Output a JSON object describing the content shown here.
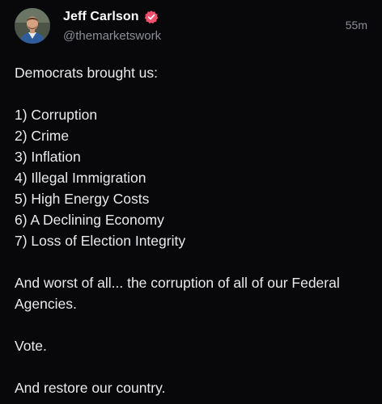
{
  "author": {
    "display_name": "Jeff Carlson",
    "handle": "@themarketswork",
    "verified_badge_color": "#f0506e",
    "avatar_icon": "profile-photo"
  },
  "post": {
    "timestamp": "55m",
    "intro": "Democrats brought us:",
    "list": [
      "1) Corruption",
      "2) Crime",
      "3) Inflation",
      "4) Illegal Immigration",
      "5) High Energy Costs",
      "6) A Declining Economy",
      "7) Loss of Election Integrity"
    ],
    "paragraph_1": "And worst of all... the corruption of all of our Federal Agencies.",
    "paragraph_2": "Vote.",
    "paragraph_3": "And restore our country."
  },
  "colors": {
    "background": "#08080b",
    "text": "#e9eaec",
    "secondary_text": "#8b8f96"
  }
}
